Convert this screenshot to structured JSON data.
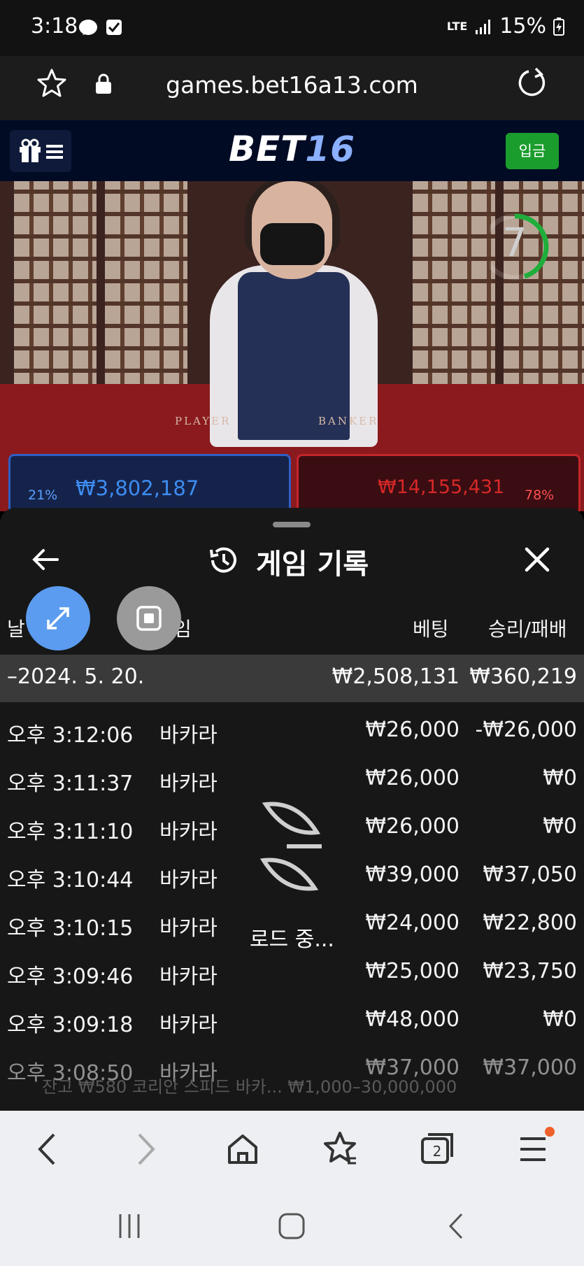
{
  "status_bar": {
    "time": "3:18",
    "network": "LTE",
    "battery": "15%"
  },
  "browser": {
    "url": "games.bet16a13.com"
  },
  "site": {
    "logo_part1": "BET",
    "logo_part2": "16",
    "deposit_label": "입금"
  },
  "video": {
    "timer": "7",
    "table_label_player": "PLAYER",
    "table_label_banker": "BANKER",
    "player_amount": "₩3,802,187",
    "player_pct": "21%",
    "banker_amount": "₩14,155,431",
    "banker_pct": "78%"
  },
  "sheet": {
    "title": "게임 기록",
    "columns": {
      "date": "날",
      "game": "임",
      "bet": "베팅",
      "win_loss": "승리/패배"
    },
    "summary": {
      "date": "–2024. 5. 20.",
      "bet": "₩2,508,131",
      "win_loss": "₩360,219"
    },
    "rows": [
      {
        "time": "오후 3:12:06",
        "game": "바카라",
        "bet": "₩26,000",
        "win_loss": "-₩26,000"
      },
      {
        "time": "오후 3:11:37",
        "game": "바카라",
        "bet": "₩26,000",
        "win_loss": "₩0"
      },
      {
        "time": "오후 3:11:10",
        "game": "바카라",
        "bet": "₩26,000",
        "win_loss": "₩0"
      },
      {
        "time": "오후 3:10:44",
        "game": "바카라",
        "bet": "₩39,000",
        "win_loss": "₩37,050"
      },
      {
        "time": "오후 3:10:15",
        "game": "바카라",
        "bet": "₩24,000",
        "win_loss": "₩22,800"
      },
      {
        "time": "오후 3:09:46",
        "game": "바카라",
        "bet": "₩25,000",
        "win_loss": "₩23,750"
      },
      {
        "time": "오후 3:09:18",
        "game": "바카라",
        "bet": "₩48,000",
        "win_loss": "₩0"
      },
      {
        "time": "오후 3:08:50",
        "game": "바카라",
        "bet": "₩37,000",
        "win_loss": "₩37,000"
      }
    ],
    "loading_text": "로드 중...",
    "background_footer": "잔고 ₩580   코리안 스피드 바카...  ₩1,000–30,000,000"
  },
  "toolbar": {
    "tabs_count": "2"
  },
  "colors": {
    "deposit_green": "#1a9d2c",
    "player_blue": "#2f5fc4",
    "banker_red": "#c4262a",
    "expand_blue": "#5b9cf0"
  }
}
